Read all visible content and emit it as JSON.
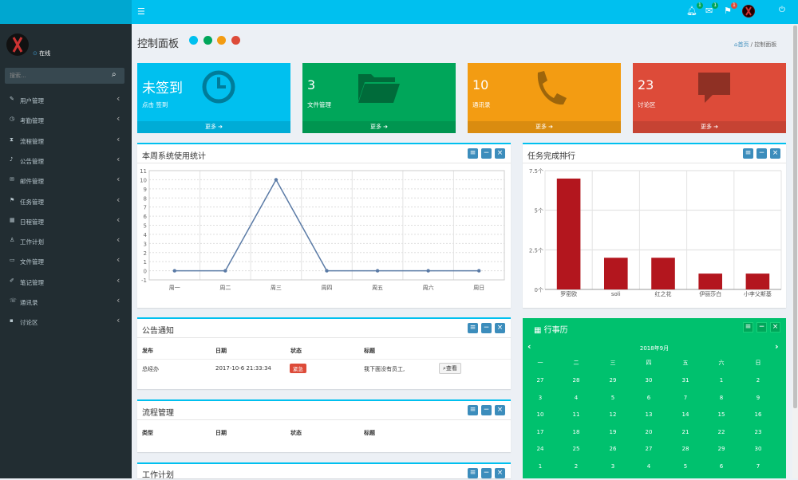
{
  "header": {
    "menu_icon": "hamburger-icon",
    "notif_count": "1",
    "mail_count": "1",
    "flag_count": "1"
  },
  "sidebar": {
    "status": "在线",
    "search_placeholder": "搜索...",
    "items": [
      {
        "label": "用户管理",
        "icon": "edit-icon"
      },
      {
        "label": "考勤管理",
        "icon": "clock-icon"
      },
      {
        "label": "流程管理",
        "icon": "hourglass-icon"
      },
      {
        "label": "公告管理",
        "icon": "bell-icon"
      },
      {
        "label": "邮件管理",
        "icon": "mail-icon"
      },
      {
        "label": "任务管理",
        "icon": "flag-icon"
      },
      {
        "label": "日程管理",
        "icon": "calendar-icon"
      },
      {
        "label": "工作计划",
        "icon": "person-icon"
      },
      {
        "label": "文件管理",
        "icon": "folder-icon"
      },
      {
        "label": "笔记管理",
        "icon": "note-icon"
      },
      {
        "label": "通讯录",
        "icon": "phone-icon"
      },
      {
        "label": "讨论区",
        "icon": "comment-icon"
      }
    ]
  },
  "page": {
    "title": "控制面板",
    "breadcrumb_home": "首页",
    "breadcrumb_current": "控制面板"
  },
  "colors": {
    "cyan": "#00c0ef",
    "green": "#00a65a",
    "orange": "#f39c12",
    "red": "#dd4b39",
    "blue": "#3c8dbc"
  },
  "stats": [
    {
      "value": "未签到",
      "label": "点击 签到",
      "footer": "更多",
      "color": "#00c0ef",
      "icon": "clock-icon"
    },
    {
      "value": "3",
      "label": "文件管理",
      "footer": "更多",
      "color": "#00a65a",
      "icon": "folder-icon"
    },
    {
      "value": "10",
      "label": "通讯录",
      "footer": "更多",
      "color": "#f39c12",
      "icon": "phone-icon"
    },
    {
      "value": "23",
      "label": "讨论区",
      "footer": "更多",
      "color": "#dd4b39",
      "icon": "comment-icon"
    }
  ],
  "usage": {
    "title": "本周系统使用统计"
  },
  "ranking": {
    "title": "任务完成排行"
  },
  "notice": {
    "title": "公告通知",
    "headers": [
      "发布",
      "日期",
      "状态",
      "标题"
    ],
    "rows": [
      {
        "publisher": "总经办",
        "date": "2017-10-6 21:33:34",
        "status": "紧急",
        "title": "我下面没有员工,",
        "action": "查看"
      }
    ]
  },
  "process": {
    "title": "流程管理",
    "headers": [
      "类型",
      "日期",
      "状态",
      "标题"
    ]
  },
  "plan": {
    "title": "工作计划"
  },
  "calendar": {
    "title": "行事历",
    "month": "2018年9月",
    "prev": "‹",
    "next": "›",
    "weekdays": [
      "一",
      "二",
      "三",
      "四",
      "五",
      "六",
      "日"
    ],
    "weeks": [
      [
        "27",
        "28",
        "29",
        "30",
        "31",
        "1",
        "2"
      ],
      [
        "3",
        "4",
        "5",
        "6",
        "7",
        "8",
        "9"
      ],
      [
        "10",
        "11",
        "12",
        "13",
        "14",
        "15",
        "16"
      ],
      [
        "17",
        "18",
        "19",
        "20",
        "21",
        "22",
        "23"
      ],
      [
        "24",
        "25",
        "26",
        "27",
        "28",
        "29",
        "30"
      ],
      [
        "1",
        "2",
        "3",
        "4",
        "5",
        "6",
        "7"
      ]
    ]
  },
  "chart_data": [
    {
      "type": "line",
      "title": "",
      "categories": [
        "周一",
        "周二",
        "周三",
        "周四",
        "周五",
        "周六",
        "周日"
      ],
      "series": [
        {
          "values": [
            0,
            0,
            10,
            0,
            0,
            0,
            0
          ]
        }
      ],
      "ylim": [
        -1,
        11
      ],
      "yticks": [
        "-1",
        "0",
        "1",
        "2",
        "3",
        "4",
        "5",
        "6",
        "7",
        "8",
        "9",
        "10",
        "11"
      ],
      "grid": true,
      "color": "#5b7ba6"
    },
    {
      "type": "bar",
      "title": "",
      "categories": [
        "罗密欧",
        "soli",
        "红之花",
        "伊丽莎白",
        "小李父斯基"
      ],
      "series": [
        {
          "values": [
            7,
            2,
            2,
            1,
            1
          ]
        }
      ],
      "ylim": [
        0,
        7.5
      ],
      "yticks": [
        "0个",
        "2.5个",
        "5个",
        "7.5个"
      ],
      "grid": true,
      "color": "#b3161e"
    }
  ]
}
